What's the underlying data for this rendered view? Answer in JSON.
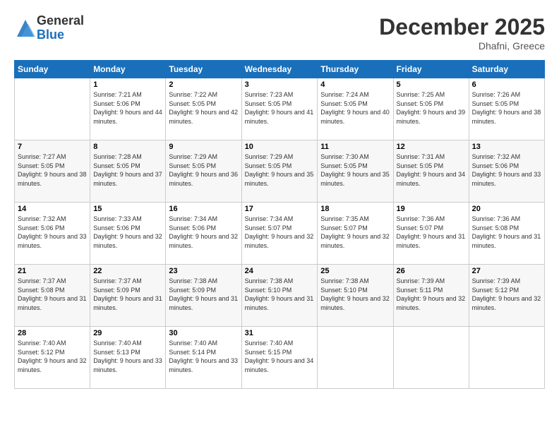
{
  "logo": {
    "line1": "General",
    "line2": "Blue"
  },
  "title": "December 2025",
  "location": "Dhafni, Greece",
  "days_header": [
    "Sunday",
    "Monday",
    "Tuesday",
    "Wednesday",
    "Thursday",
    "Friday",
    "Saturday"
  ],
  "weeks": [
    [
      {
        "day": "",
        "sunrise": "",
        "sunset": "",
        "daylight": ""
      },
      {
        "day": "1",
        "sunrise": "Sunrise: 7:21 AM",
        "sunset": "Sunset: 5:06 PM",
        "daylight": "Daylight: 9 hours and 44 minutes."
      },
      {
        "day": "2",
        "sunrise": "Sunrise: 7:22 AM",
        "sunset": "Sunset: 5:05 PM",
        "daylight": "Daylight: 9 hours and 42 minutes."
      },
      {
        "day": "3",
        "sunrise": "Sunrise: 7:23 AM",
        "sunset": "Sunset: 5:05 PM",
        "daylight": "Daylight: 9 hours and 41 minutes."
      },
      {
        "day": "4",
        "sunrise": "Sunrise: 7:24 AM",
        "sunset": "Sunset: 5:05 PM",
        "daylight": "Daylight: 9 hours and 40 minutes."
      },
      {
        "day": "5",
        "sunrise": "Sunrise: 7:25 AM",
        "sunset": "Sunset: 5:05 PM",
        "daylight": "Daylight: 9 hours and 39 minutes."
      },
      {
        "day": "6",
        "sunrise": "Sunrise: 7:26 AM",
        "sunset": "Sunset: 5:05 PM",
        "daylight": "Daylight: 9 hours and 38 minutes."
      }
    ],
    [
      {
        "day": "7",
        "sunrise": "Sunrise: 7:27 AM",
        "sunset": "Sunset: 5:05 PM",
        "daylight": "Daylight: 9 hours and 38 minutes."
      },
      {
        "day": "8",
        "sunrise": "Sunrise: 7:28 AM",
        "sunset": "Sunset: 5:05 PM",
        "daylight": "Daylight: 9 hours and 37 minutes."
      },
      {
        "day": "9",
        "sunrise": "Sunrise: 7:29 AM",
        "sunset": "Sunset: 5:05 PM",
        "daylight": "Daylight: 9 hours and 36 minutes."
      },
      {
        "day": "10",
        "sunrise": "Sunrise: 7:29 AM",
        "sunset": "Sunset: 5:05 PM",
        "daylight": "Daylight: 9 hours and 35 minutes."
      },
      {
        "day": "11",
        "sunrise": "Sunrise: 7:30 AM",
        "sunset": "Sunset: 5:05 PM",
        "daylight": "Daylight: 9 hours and 35 minutes."
      },
      {
        "day": "12",
        "sunrise": "Sunrise: 7:31 AM",
        "sunset": "Sunset: 5:05 PM",
        "daylight": "Daylight: 9 hours and 34 minutes."
      },
      {
        "day": "13",
        "sunrise": "Sunrise: 7:32 AM",
        "sunset": "Sunset: 5:06 PM",
        "daylight": "Daylight: 9 hours and 33 minutes."
      }
    ],
    [
      {
        "day": "14",
        "sunrise": "Sunrise: 7:32 AM",
        "sunset": "Sunset: 5:06 PM",
        "daylight": "Daylight: 9 hours and 33 minutes."
      },
      {
        "day": "15",
        "sunrise": "Sunrise: 7:33 AM",
        "sunset": "Sunset: 5:06 PM",
        "daylight": "Daylight: 9 hours and 32 minutes."
      },
      {
        "day": "16",
        "sunrise": "Sunrise: 7:34 AM",
        "sunset": "Sunset: 5:06 PM",
        "daylight": "Daylight: 9 hours and 32 minutes."
      },
      {
        "day": "17",
        "sunrise": "Sunrise: 7:34 AM",
        "sunset": "Sunset: 5:07 PM",
        "daylight": "Daylight: 9 hours and 32 minutes."
      },
      {
        "day": "18",
        "sunrise": "Sunrise: 7:35 AM",
        "sunset": "Sunset: 5:07 PM",
        "daylight": "Daylight: 9 hours and 32 minutes."
      },
      {
        "day": "19",
        "sunrise": "Sunrise: 7:36 AM",
        "sunset": "Sunset: 5:07 PM",
        "daylight": "Daylight: 9 hours and 31 minutes."
      },
      {
        "day": "20",
        "sunrise": "Sunrise: 7:36 AM",
        "sunset": "Sunset: 5:08 PM",
        "daylight": "Daylight: 9 hours and 31 minutes."
      }
    ],
    [
      {
        "day": "21",
        "sunrise": "Sunrise: 7:37 AM",
        "sunset": "Sunset: 5:08 PM",
        "daylight": "Daylight: 9 hours and 31 minutes."
      },
      {
        "day": "22",
        "sunrise": "Sunrise: 7:37 AM",
        "sunset": "Sunset: 5:09 PM",
        "daylight": "Daylight: 9 hours and 31 minutes."
      },
      {
        "day": "23",
        "sunrise": "Sunrise: 7:38 AM",
        "sunset": "Sunset: 5:09 PM",
        "daylight": "Daylight: 9 hours and 31 minutes."
      },
      {
        "day": "24",
        "sunrise": "Sunrise: 7:38 AM",
        "sunset": "Sunset: 5:10 PM",
        "daylight": "Daylight: 9 hours and 31 minutes."
      },
      {
        "day": "25",
        "sunrise": "Sunrise: 7:38 AM",
        "sunset": "Sunset: 5:10 PM",
        "daylight": "Daylight: 9 hours and 32 minutes."
      },
      {
        "day": "26",
        "sunrise": "Sunrise: 7:39 AM",
        "sunset": "Sunset: 5:11 PM",
        "daylight": "Daylight: 9 hours and 32 minutes."
      },
      {
        "day": "27",
        "sunrise": "Sunrise: 7:39 AM",
        "sunset": "Sunset: 5:12 PM",
        "daylight": "Daylight: 9 hours and 32 minutes."
      }
    ],
    [
      {
        "day": "28",
        "sunrise": "Sunrise: 7:40 AM",
        "sunset": "Sunset: 5:12 PM",
        "daylight": "Daylight: 9 hours and 32 minutes."
      },
      {
        "day": "29",
        "sunrise": "Sunrise: 7:40 AM",
        "sunset": "Sunset: 5:13 PM",
        "daylight": "Daylight: 9 hours and 33 minutes."
      },
      {
        "day": "30",
        "sunrise": "Sunrise: 7:40 AM",
        "sunset": "Sunset: 5:14 PM",
        "daylight": "Daylight: 9 hours and 33 minutes."
      },
      {
        "day": "31",
        "sunrise": "Sunrise: 7:40 AM",
        "sunset": "Sunset: 5:15 PM",
        "daylight": "Daylight: 9 hours and 34 minutes."
      },
      {
        "day": "",
        "sunrise": "",
        "sunset": "",
        "daylight": ""
      },
      {
        "day": "",
        "sunrise": "",
        "sunset": "",
        "daylight": ""
      },
      {
        "day": "",
        "sunrise": "",
        "sunset": "",
        "daylight": ""
      }
    ]
  ]
}
